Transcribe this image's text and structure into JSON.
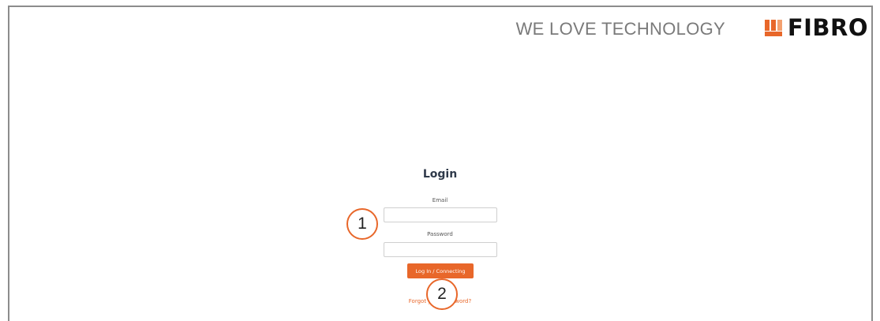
{
  "header": {
    "tagline": "WE LOVE TECHNOLOGY",
    "logo_text": "FIBRO",
    "logo_icon": "fibro-logo-icon",
    "brand_color": "#e8672a"
  },
  "login": {
    "title": "Login",
    "email_label": "Email",
    "email_value": "",
    "password_label": "Password",
    "password_value": "",
    "submit_label": "Log In / Connecting",
    "forgot_label": "Forgot your password?"
  },
  "callouts": {
    "one": "1",
    "two": "2"
  }
}
